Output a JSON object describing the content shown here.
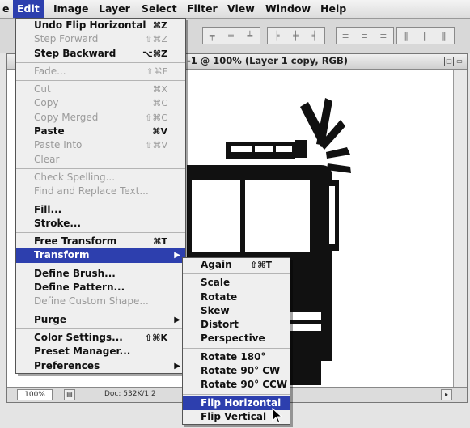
{
  "menubar": {
    "items": [
      "e",
      "Edit",
      "Image",
      "Layer",
      "Select",
      "Filter",
      "View",
      "Window",
      "Help"
    ],
    "active_index": 1
  },
  "document": {
    "title": "-1 @ 100% (Layer 1 copy, RGB)",
    "zoom": "100%",
    "doc_info": "Doc: 532K/1.2"
  },
  "edit_menu": [
    {
      "label": "Undo Flip Horizontal",
      "shortcut": "⌘Z",
      "enabled": true
    },
    {
      "label": "Step Forward",
      "shortcut": "⇧⌘Z",
      "enabled": false
    },
    {
      "label": "Step Backward",
      "shortcut": "⌥⌘Z",
      "enabled": true
    },
    {
      "sep": true
    },
    {
      "label": "Fade...",
      "shortcut": "⇧⌘F",
      "enabled": false
    },
    {
      "sep": true
    },
    {
      "label": "Cut",
      "shortcut": "⌘X",
      "enabled": false
    },
    {
      "label": "Copy",
      "shortcut": "⌘C",
      "enabled": false
    },
    {
      "label": "Copy Merged",
      "shortcut": "⇧⌘C",
      "enabled": false
    },
    {
      "label": "Paste",
      "shortcut": "⌘V",
      "enabled": true
    },
    {
      "label": "Paste Into",
      "shortcut": "⇧⌘V",
      "enabled": false
    },
    {
      "label": "Clear",
      "shortcut": "",
      "enabled": false
    },
    {
      "sep": true
    },
    {
      "label": "Check Spelling...",
      "shortcut": "",
      "enabled": false
    },
    {
      "label": "Find and Replace Text...",
      "shortcut": "",
      "enabled": false
    },
    {
      "sep": true
    },
    {
      "label": "Fill...",
      "shortcut": "",
      "enabled": true
    },
    {
      "label": "Stroke...",
      "shortcut": "",
      "enabled": true
    },
    {
      "sep": true
    },
    {
      "label": "Free Transform",
      "shortcut": "⌘T",
      "enabled": true
    },
    {
      "label": "Transform",
      "shortcut": "",
      "enabled": true,
      "submenu": true,
      "highlighted": true
    },
    {
      "sep": true
    },
    {
      "label": "Define Brush...",
      "shortcut": "",
      "enabled": true
    },
    {
      "label": "Define Pattern...",
      "shortcut": "",
      "enabled": true
    },
    {
      "label": "Define Custom Shape...",
      "shortcut": "",
      "enabled": false
    },
    {
      "sep": true
    },
    {
      "label": "Purge",
      "shortcut": "",
      "enabled": true,
      "submenu": true
    },
    {
      "sep": true
    },
    {
      "label": "Color Settings...",
      "shortcut": "⇧⌘K",
      "enabled": true
    },
    {
      "label": "Preset Manager...",
      "shortcut": "",
      "enabled": true
    },
    {
      "label": "Preferences",
      "shortcut": "",
      "enabled": true,
      "submenu": true
    }
  ],
  "transform_menu": [
    {
      "label": "Again",
      "shortcut": "⇧⌘T",
      "enabled": true
    },
    {
      "sep": true
    },
    {
      "label": "Scale",
      "enabled": true
    },
    {
      "label": "Rotate",
      "enabled": true
    },
    {
      "label": "Skew",
      "enabled": true
    },
    {
      "label": "Distort",
      "enabled": true
    },
    {
      "label": "Perspective",
      "enabled": true
    },
    {
      "sep": true
    },
    {
      "label": "Rotate 180°",
      "enabled": true
    },
    {
      "label": "Rotate 90° CW",
      "enabled": true
    },
    {
      "label": "Rotate 90° CCW",
      "enabled": true
    },
    {
      "sep": true
    },
    {
      "label": "Flip Horizontal",
      "enabled": true,
      "highlighted": true
    },
    {
      "label": "Flip Vertical",
      "enabled": true
    }
  ],
  "icons": {
    "submenu_arrow": "triangle-right-icon",
    "pointer": "arrow-cursor-icon"
  },
  "colors": {
    "highlight": "#2d3fae",
    "menu_bg": "#efefef",
    "disabled": "#9a9a9a",
    "artwork": "#111111"
  }
}
